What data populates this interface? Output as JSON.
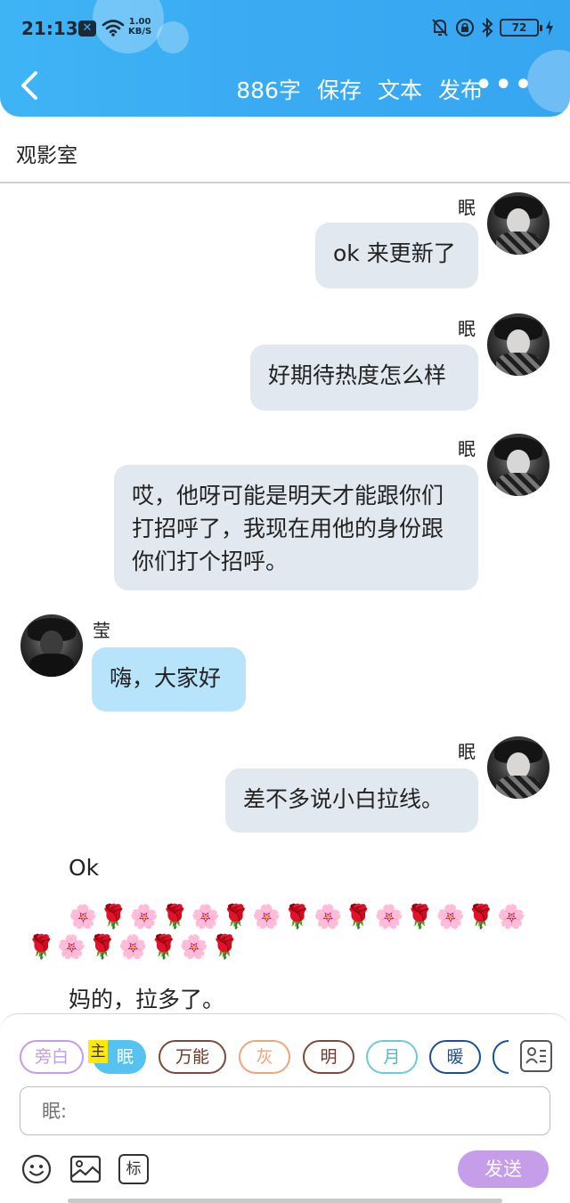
{
  "status_bar": {
    "time": "21:13",
    "x_badge": "✕",
    "speed_value": "1.00",
    "speed_unit": "KB/S",
    "battery": "72"
  },
  "header": {
    "word_count": "886字",
    "save": "保存",
    "text": "文本",
    "publish": "发布",
    "more": "•••"
  },
  "title": "观影室",
  "messages": [
    {
      "sender": "眠",
      "text": "ok 来更新了",
      "side": "right"
    },
    {
      "sender": "眠",
      "text": "好期待热度怎么样",
      "side": "right"
    },
    {
      "sender": "眠",
      "text": "哎，他呀可能是明天才能跟你们打招呼了，我现在用他的身份跟你们打个招呼。",
      "side": "right"
    },
    {
      "sender": "莹",
      "text": "嗨，大家好",
      "side": "left"
    },
    {
      "sender": "眠",
      "text": "差不多说小白拉线。",
      "side": "right"
    }
  ],
  "narration": [
    "Ok",
    "🌸🌹🌸🌹🌸🌹🌸🌹🌸🌹🌸🌹🌸🌹🌸",
    "🌹🌸🌹🌸🌹🌸🌹",
    "妈的，拉多了。"
  ],
  "chips": {
    "aside": "旁白",
    "main_tag": "主",
    "main": "眠",
    "universal": "万能",
    "gray": "灰",
    "ming": "明",
    "yue": "月",
    "nuan": "暖"
  },
  "input": {
    "placeholder": "眠:"
  },
  "toolbar": {
    "mark": "标",
    "send": "发送"
  },
  "icons": [
    "back-arrow-icon",
    "mute-bell-icon",
    "lock-rotation-icon",
    "bluetooth-icon",
    "charging-icon",
    "wifi-icon",
    "contact-card-icon",
    "emoji-icon",
    "image-icon"
  ],
  "colors": {
    "header": "#3fb4f5",
    "right_bubble": "#e2e8ef",
    "left_bubble": "#b7e3fb",
    "send": "#c59de9"
  }
}
